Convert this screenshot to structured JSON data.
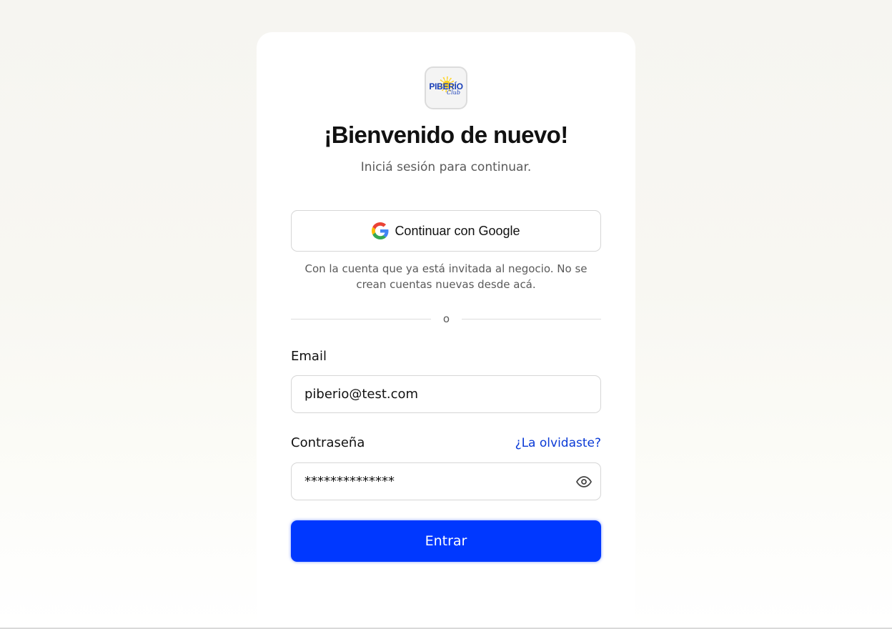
{
  "brand": {
    "logo_text": "PIBERÍO",
    "logo_subtext": "Club",
    "logo_color": "#1a3fb8",
    "logo_sun_color": "#ffd21f"
  },
  "header": {
    "title": "¡Bienvenido de nuevo!",
    "subtitle": "Iniciá sesión para continuar."
  },
  "google": {
    "label": "Continuar con Google",
    "icon": "google-icon",
    "note": "Con la cuenta que ya está invitada al negocio. No se crean cuentas nuevas desde acá."
  },
  "divider": {
    "text": "o"
  },
  "form": {
    "email": {
      "label": "Email",
      "value": "piberio@test.com"
    },
    "password": {
      "label": "Contraseña",
      "value": "**************",
      "forgot_link": "¿La olvidaste?",
      "toggle_icon": "eye-icon"
    },
    "submit_label": "Entrar"
  },
  "colors": {
    "primary": "#0038ff",
    "link": "#0a3ad6",
    "text": "#111111",
    "muted": "#5a5a5a",
    "border": "#d6d6d6"
  }
}
